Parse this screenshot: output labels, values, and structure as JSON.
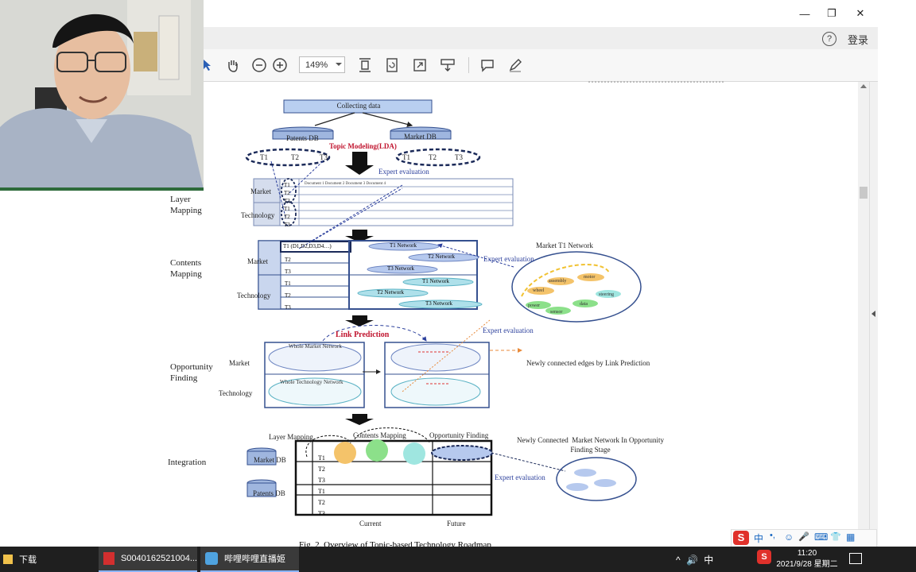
{
  "window": {
    "minimize_label": "—",
    "restore_label": "❐",
    "close_label": "✕"
  },
  "menubar": {
    "help_label": "?",
    "login_label": "登录"
  },
  "toolbar": {
    "zoom_value": "149%",
    "icons": [
      "pointer-icon",
      "hand-icon",
      "zoom-out-icon",
      "zoom-in-icon",
      "fit-page-icon",
      "rotate-icon",
      "fullscreen-icon",
      "download-icon",
      "comment-icon",
      "pen-icon"
    ]
  },
  "figure": {
    "collecting_data": "Collecting  data",
    "patents_db": "Patents DB",
    "market_db": "Market DB",
    "topic_modeling": "Topic Modeling(LDA)",
    "t_labels": [
      "T1",
      "T2",
      "T3",
      "T1",
      "T2",
      "T3"
    ],
    "expert_evaluation": "Expert evaluation",
    "layer_mapping_label": "Layer\nMapping",
    "contents_mapping_label": "Contents\nMapping",
    "opportunity_finding_label": "Opportunity\nFinding",
    "integration_label": "Integration",
    "market": "Market",
    "technology": "Technology",
    "layer_rows": [
      "T1",
      "T2",
      "T3",
      "T1",
      "T2",
      "T3"
    ],
    "document_header": "Document 1 Document 2 Document 3 Document 4",
    "contents_first_cell": "T1 (D1,D2,D3,D4…)",
    "contents_rows": [
      "T2",
      "T3",
      "T1",
      "T2",
      "T3"
    ],
    "networks": [
      "T1 Network",
      "T2 Network",
      "T3 Network",
      "T1 Network",
      "T2 Network",
      "T3 Network"
    ],
    "market_t1_network": "Market T1 Network",
    "network_nodes": [
      "assembly",
      "motor",
      "wheel",
      "steering",
      "power",
      "data",
      "sensor"
    ],
    "link_prediction": "Link Prediction",
    "whole_market_network": "Whole Market Network",
    "whole_technology_network": "Whole Technology Network",
    "newly_connected_edges": "Newly connected edges by Link Prediction",
    "integration_headers": [
      "Layer Mapping",
      "Contents Mapping",
      "Opportunity Finding"
    ],
    "integration_rows": [
      "T1",
      "T2",
      "T3",
      "T1",
      "T2",
      "T3"
    ],
    "market_db2": "Market DB",
    "patents_db2": "Patents DB",
    "current": "Current",
    "future": "Future",
    "newly_connected_market": "Newly Connected  Market Network In Opportunity\nFinding Stage",
    "caption": "Fig. 2.  Overview of Topic-based Technology Roadmap"
  },
  "ime": {
    "labels": [
      "S",
      "中",
      "•,",
      "☺",
      "🎤",
      "⌨",
      "👕",
      "▦"
    ]
  },
  "taskbar": {
    "items": [
      {
        "label": "下载"
      },
      {
        "label": "S0040162521004..."
      },
      {
        "label": "哔哩哔哩直播姬"
      }
    ],
    "tray": "^ 🔊 中",
    "time": "11:20",
    "date": "2021/9/28 星期二"
  }
}
